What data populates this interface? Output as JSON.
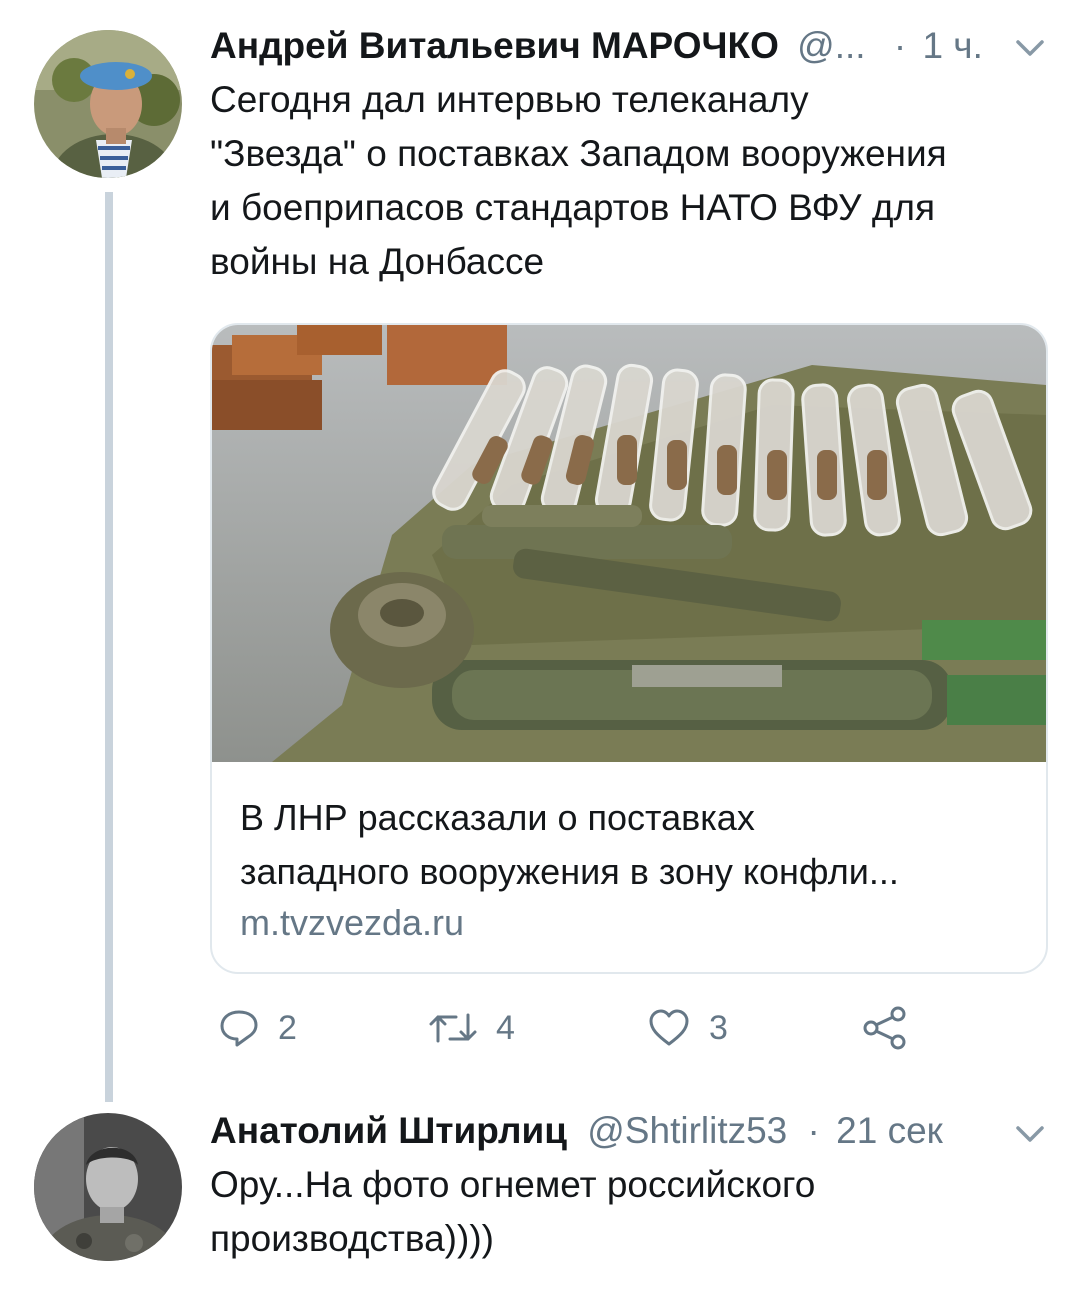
{
  "tweet1": {
    "author_name": "Андрей Витальевич МАРОЧКО",
    "handle": "@...",
    "separator": "·",
    "time": "1 ч.",
    "text_lines": [
      "Сегодня дал интервью телеканалу",
      "\"Звезда\" о поставках Западом вооружения",
      "и боеприпасов стандартов НАТО ВФУ для",
      "войны на Донбассе"
    ],
    "card": {
      "title_lines": [
        "В ЛНР рассказали о поставках",
        "западного вооружения в зону конфли..."
      ],
      "domain": "m.tvzvezda.ru"
    },
    "actions": {
      "replies": "2",
      "retweets": "4",
      "likes": "3"
    }
  },
  "tweet2": {
    "author_name": "Анатолий Штирлиц",
    "handle": "@Shtirlitz53",
    "separator": "·",
    "time": "21 сек",
    "text_lines": [
      "Ору...На фото огнемет российского",
      "производства))))"
    ]
  },
  "icons": {
    "reply": "reply-icon",
    "retweet": "retweet-icon",
    "like": "heart-icon",
    "share": "share-icon",
    "caret": "chevron-down-icon"
  },
  "colors": {
    "text": "#14171a",
    "secondary": "#657786",
    "thread_line": "#c9d3dc",
    "card_border": "#e1e8ed"
  }
}
